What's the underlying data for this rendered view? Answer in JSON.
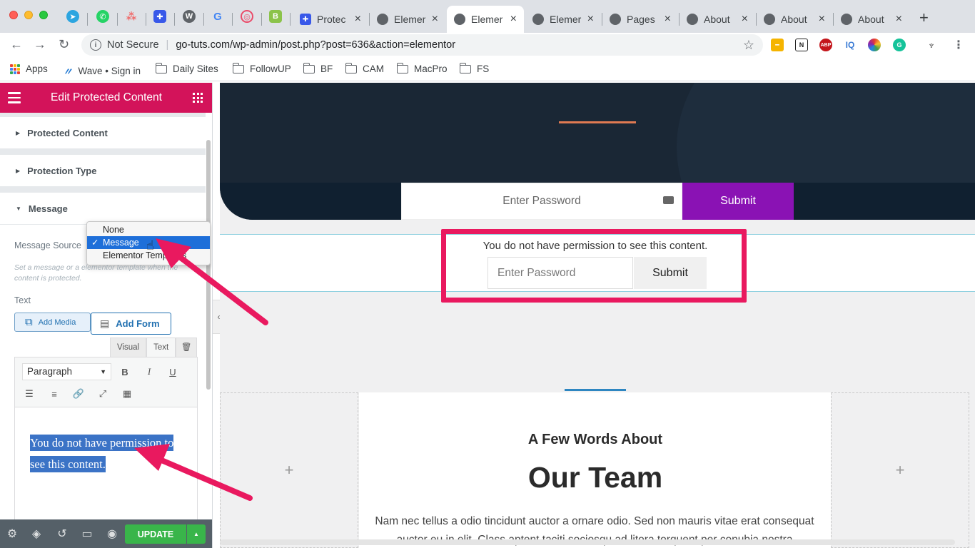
{
  "browser": {
    "tabs": [
      {
        "label": "Protec"
      },
      {
        "label": "Elemer"
      },
      {
        "label": "Elemer"
      },
      {
        "label": "Elemer"
      },
      {
        "label": "Pages"
      },
      {
        "label": "About"
      },
      {
        "label": "About"
      },
      {
        "label": "About"
      }
    ],
    "not_secure": "Not Secure",
    "url": "go-tuts.com/wp-admin/post.php?post=636&action=elementor",
    "bookmarks": [
      "Apps",
      "Wave • Sign in",
      "Daily Sites",
      "FollowUP",
      "BF",
      "CAM",
      "MacPro",
      "FS"
    ],
    "extensions": [
      "N",
      "ABP",
      "IQ"
    ]
  },
  "panel": {
    "title": "Edit Protected Content",
    "sections": [
      "Protected Content",
      "Protection Type",
      "Message"
    ],
    "message_source_label": "Message Source",
    "message_source_options": [
      "None",
      "Message",
      "Elementor Templates"
    ],
    "message_source_selected": "Message",
    "description": "Set a message or a elementor template when the content is protected.",
    "text_label": "Text",
    "add_media": "Add Media",
    "add_form": "Add Form",
    "editor_tabs": [
      "Visual",
      "Text"
    ],
    "format": "Paragraph",
    "format_buttons": [
      "B",
      "I",
      "U"
    ],
    "editor_text": "You do not have permission to see this content.",
    "update": "UPDATE"
  },
  "canvas": {
    "password_placeholder": "Enter Password",
    "submit": "Submit",
    "permission_text": "You do not have permission to see this content.",
    "password_placeholder_2": "Enter Password",
    "submit_2": "Submit",
    "plus": "+",
    "heading_small": "A Few Words About",
    "heading_large": "Our Team",
    "body_text": "Nam nec tellus a odio tincidunt auctor a ornare odio. Sed non mauris vitae erat consequat auctor eu in elit. Class aptent taciti sociosqu ad litora torquent per conubia nostra"
  },
  "colors": {
    "elementor_pink": "#d3135a",
    "highlight_red": "#e9195f",
    "submit_purple": "#8a12b4",
    "update_green": "#39b54a"
  }
}
